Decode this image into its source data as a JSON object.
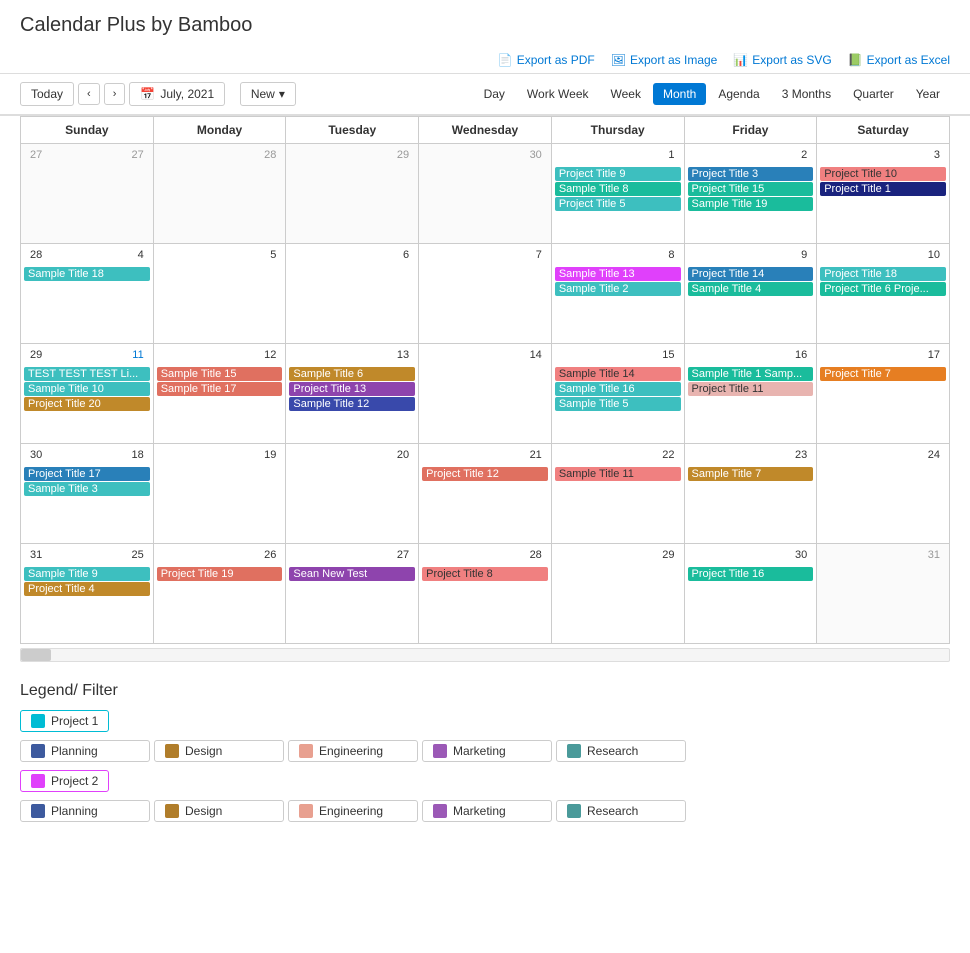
{
  "app": {
    "title": "Calendar Plus by Bamboo"
  },
  "exports": [
    {
      "id": "pdf",
      "label": "Export as PDF",
      "icon": "pdf"
    },
    {
      "id": "image",
      "label": "Export as Image",
      "icon": "img"
    },
    {
      "id": "svg",
      "label": "Export as SVG",
      "icon": "svg"
    },
    {
      "id": "excel",
      "label": "Export as Excel",
      "icon": "xls"
    }
  ],
  "nav": {
    "today": "Today",
    "prev": "‹",
    "next": "›",
    "current_date": "July, 2021",
    "new_button": "New",
    "dropdown_arrow": "▾"
  },
  "view_tabs": [
    {
      "id": "day",
      "label": "Day"
    },
    {
      "id": "workweek",
      "label": "Work Week"
    },
    {
      "id": "week",
      "label": "Week"
    },
    {
      "id": "month",
      "label": "Month",
      "active": true
    },
    {
      "id": "agenda",
      "label": "Agenda"
    },
    {
      "id": "3months",
      "label": "3 Months"
    },
    {
      "id": "quarter",
      "label": "Quarter"
    },
    {
      "id": "year",
      "label": "Year"
    }
  ],
  "calendar": {
    "headers": [
      "Sunday",
      "Monday",
      "Tuesday",
      "Wednesday",
      "Thursday",
      "Friday",
      "Saturday"
    ],
    "weeks": [
      {
        "week_num": 27,
        "days": [
          {
            "date": 27,
            "other_month": true,
            "events": []
          },
          {
            "date": 28,
            "other_month": true,
            "events": []
          },
          {
            "date": 29,
            "other_month": true,
            "events": []
          },
          {
            "date": 30,
            "other_month": true,
            "events": []
          },
          {
            "date": 1,
            "events": [
              {
                "label": "Project Title 9",
                "class": "ev-cyan"
              },
              {
                "label": "Sample Title 8",
                "class": "ev-teal"
              },
              {
                "label": "Project Title 5",
                "class": "ev-cyan"
              }
            ]
          },
          {
            "date": 2,
            "events": [
              {
                "label": "Project Title 3",
                "class": "ev-blue"
              },
              {
                "label": "Project Title 15",
                "class": "ev-teal"
              },
              {
                "label": "Sample Title 19",
                "class": "ev-teal"
              }
            ]
          },
          {
            "date": 3,
            "events": [
              {
                "label": "Project Title 10",
                "class": "ev-salmon"
              },
              {
                "label": "Project Title 1",
                "class": "ev-darkblue"
              }
            ]
          }
        ]
      },
      {
        "week_num": 28,
        "days": [
          {
            "date": 4,
            "events": [
              {
                "label": "Sample Title 18",
                "class": "ev-cyan"
              }
            ]
          },
          {
            "date": 5,
            "events": []
          },
          {
            "date": 6,
            "events": []
          },
          {
            "date": 7,
            "events": []
          },
          {
            "date": 8,
            "events": [
              {
                "label": "Sample Title 13",
                "class": "ev-magenta"
              },
              {
                "label": "Sample Title 2",
                "class": "ev-cyan"
              }
            ]
          },
          {
            "date": 9,
            "events": [
              {
                "label": "Project Title 14",
                "class": "ev-blue"
              },
              {
                "label": "Sample Title 4",
                "class": "ev-teal"
              }
            ]
          },
          {
            "date": 10,
            "events": [
              {
                "label": "Project Title 18",
                "class": "ev-cyan"
              },
              {
                "label": "Project Title 6 Proje...",
                "class": "ev-teal"
              }
            ]
          }
        ]
      },
      {
        "week_num": 29,
        "days": [
          {
            "date": 11,
            "link": true,
            "events": [
              {
                "label": "TEST TEST TEST Li...",
                "class": "ev-cyan"
              },
              {
                "label": "Sample Title 10",
                "class": "ev-cyan"
              },
              {
                "label": "Project Title 20",
                "class": "ev-gold"
              }
            ]
          },
          {
            "date": 12,
            "events": [
              {
                "label": "Sample Title 15",
                "class": "ev-coral"
              },
              {
                "label": "Sample Title 17",
                "class": "ev-coral"
              }
            ]
          },
          {
            "date": 13,
            "events": [
              {
                "label": "Sample Title 6",
                "class": "ev-gold"
              },
              {
                "label": "Project Title 13",
                "class": "ev-purple"
              },
              {
                "label": "Sample Title 12",
                "class": "ev-indigo"
              }
            ]
          },
          {
            "date": 14,
            "events": []
          },
          {
            "date": 15,
            "events": [
              {
                "label": "Sample Title 14",
                "class": "ev-salmon"
              },
              {
                "label": "Sample Title 16",
                "class": "ev-cyan"
              },
              {
                "label": "Sample Title 5",
                "class": "ev-cyan"
              }
            ]
          },
          {
            "date": 16,
            "events": [
              {
                "label": "Sample Title 1 Samp...",
                "class": "ev-teal"
              },
              {
                "label": "Project Title 11",
                "class": "ev-pink"
              }
            ]
          },
          {
            "date": 17,
            "events": [
              {
                "label": "Project Title 7",
                "class": "ev-orange"
              }
            ]
          }
        ]
      },
      {
        "week_num": 30,
        "days": [
          {
            "date": 18,
            "events": [
              {
                "label": "Project Title 17",
                "class": "ev-blue"
              },
              {
                "label": "Sample Title 3",
                "class": "ev-cyan"
              }
            ]
          },
          {
            "date": 19,
            "events": []
          },
          {
            "date": 20,
            "events": []
          },
          {
            "date": 21,
            "events": [
              {
                "label": "Project Title 12",
                "class": "ev-coral"
              }
            ]
          },
          {
            "date": 22,
            "events": [
              {
                "label": "Sample Title 11",
                "class": "ev-salmon"
              }
            ]
          },
          {
            "date": 23,
            "events": [
              {
                "label": "Sample Title 7",
                "class": "ev-gold"
              }
            ]
          },
          {
            "date": 24,
            "events": []
          }
        ]
      },
      {
        "week_num": 31,
        "days": [
          {
            "date": 25,
            "events": [
              {
                "label": "Sample Title 9",
                "class": "ev-cyan"
              },
              {
                "label": "Project Title 4",
                "class": "ev-gold"
              }
            ]
          },
          {
            "date": 26,
            "events": [
              {
                "label": "Project Title 19",
                "class": "ev-coral"
              }
            ]
          },
          {
            "date": 27,
            "events": [
              {
                "label": "Sean New Test",
                "class": "ev-purple"
              }
            ]
          },
          {
            "date": 28,
            "events": [
              {
                "label": "Project Title 8",
                "class": "ev-salmon"
              }
            ]
          },
          {
            "date": 29,
            "events": []
          },
          {
            "date": 30,
            "events": [
              {
                "label": "Project Title 16",
                "class": "ev-teal"
              }
            ]
          },
          {
            "date": 31,
            "other_month": true,
            "events": []
          }
        ]
      }
    ]
  },
  "legend": {
    "title": "Legend/ Filter",
    "project1": {
      "label": "Project 1",
      "color": "#00bcd4",
      "categories": [
        {
          "label": "Planning",
          "color": "#3d5a9e"
        },
        {
          "label": "Design",
          "color": "#b07d2a"
        },
        {
          "label": "Engineering",
          "color": "#e8a090"
        },
        {
          "label": "Marketing",
          "color": "#9b59b6"
        },
        {
          "label": "Research",
          "color": "#4a9a9a"
        }
      ]
    },
    "project2": {
      "label": "Project 2",
      "color": "#e040fb",
      "categories": [
        {
          "label": "Planning",
          "color": "#3d5a9e"
        },
        {
          "label": "Design",
          "color": "#b07d2a"
        },
        {
          "label": "Engineering",
          "color": "#e8a090"
        },
        {
          "label": "Marketing",
          "color": "#9b59b6"
        },
        {
          "label": "Research",
          "color": "#4a9a9a"
        }
      ]
    }
  }
}
